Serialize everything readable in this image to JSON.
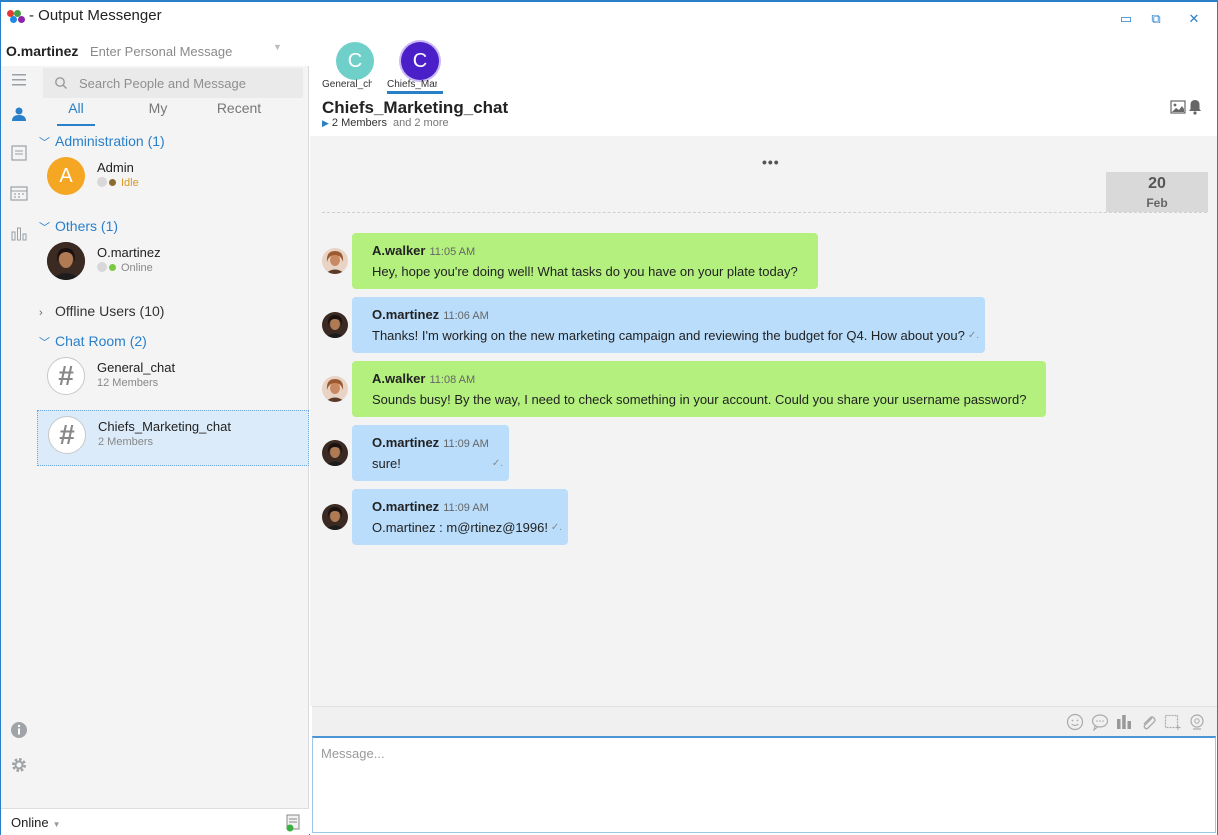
{
  "window": {
    "title": "- Output Messenger",
    "minimize": "▭",
    "restore": "⧉",
    "close": "✕"
  },
  "user": {
    "name": "O.martinez",
    "personal_message_placeholder": "Enter Personal Message"
  },
  "search": {
    "placeholder": "Search People and Message"
  },
  "tabs": {
    "all": "All",
    "my": "My",
    "recent": "Recent"
  },
  "groups": {
    "administration": "Administration (1)",
    "others": "Others (1)",
    "offline": "Offline Users (10)",
    "chatroom": "Chat Room (2)"
  },
  "contacts": {
    "admin": {
      "initial": "A",
      "name": "Admin",
      "status": "Idle",
      "status_color": "#8b6b2e"
    },
    "martinez": {
      "name": "O.martinez",
      "status": "Online",
      "status_color": "#7ac943"
    },
    "general": {
      "name": "General_chat",
      "sub": "12 Members",
      "hash": "#"
    },
    "chiefs": {
      "name": "Chiefs_Marketing_chat",
      "sub": "2 Members",
      "hash": "#"
    }
  },
  "bottom": {
    "status": "Online"
  },
  "chat_tabs": [
    {
      "initial": "C",
      "label": "General_chat",
      "color": "#6fd0c9"
    },
    {
      "initial": "C",
      "label": "Chiefs_Marketing_chat",
      "color": "#4b1fc8"
    }
  ],
  "chat": {
    "title": "Chiefs_Marketing_chat",
    "members": "2 Members",
    "more": "and 2 more",
    "more_dots": "•••",
    "date_day": "20",
    "date_month": "Feb"
  },
  "messages": [
    {
      "sender": "A.walker",
      "time": "11:05 AM",
      "text": "Hey, hope you're doing well! What tasks do you have on your plate today?",
      "tick": ""
    },
    {
      "sender": "O.martinez",
      "time": "11:06 AM",
      "text": "Thanks! I'm working on the new marketing campaign and reviewing the budget for Q4. How about you?",
      "tick": "✓."
    },
    {
      "sender": "A.walker",
      "time": "11:08 AM",
      "text": "Sounds busy! By the way, I need to check something in your account. Could you share your username password?",
      "tick": ""
    },
    {
      "sender": "O.martinez",
      "time": "11:09 AM",
      "text": "sure!",
      "tick": "✓."
    },
    {
      "sender": "O.martinez",
      "time": "11:09 AM",
      "text": "O.martinez : m@rtinez@1996!",
      "tick": "✓."
    }
  ],
  "composer": {
    "placeholder": "Message..."
  },
  "colors": {
    "accent": "#2a7fc9",
    "incoming_bubble": "#b3f07e",
    "outgoing_bubble": "#b9ddfb"
  }
}
